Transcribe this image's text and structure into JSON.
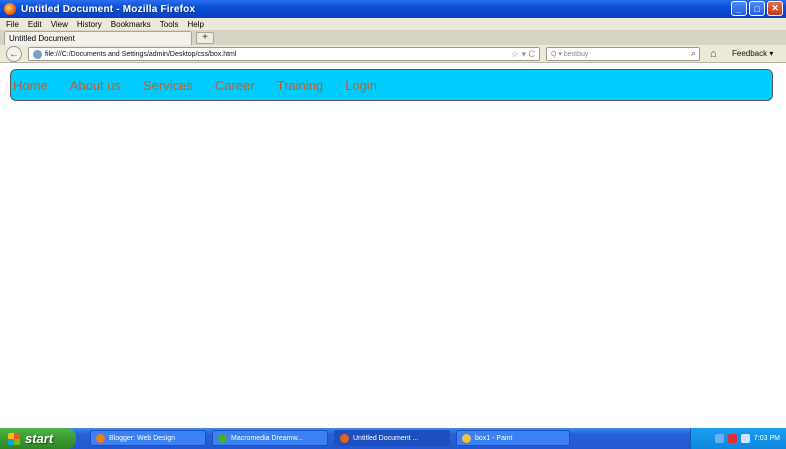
{
  "window": {
    "title": "Untitled Document - Mozilla Firefox",
    "controls": {
      "minimize": "_",
      "maximize": "□",
      "close": "✕"
    }
  },
  "menu": [
    "File",
    "Edit",
    "View",
    "History",
    "Bookmarks",
    "Tools",
    "Help"
  ],
  "tabs": [
    {
      "label": "Untitled Document"
    }
  ],
  "new_tab_label": "+",
  "navigation": {
    "back_icon": "←",
    "url": "file:///C:/Documents and Settings/admin/Desktop/css/box.html",
    "url_icons": "☆ ▾ C",
    "search_placeholder": "Q ▾ bestbuy",
    "search_icon": "magnifier-icon",
    "home_icon": "⌂",
    "feedback_label": "Feedback ▾"
  },
  "site": {
    "nav_color": "#00ccff",
    "link_color": "#cc5a1e",
    "nav_items": [
      "Home",
      "About us",
      "Services",
      "Career",
      "Training",
      "Login"
    ]
  },
  "taskbar": {
    "start_label": "start",
    "tasks": [
      {
        "label": "Blogger: Web Design",
        "icon_color": "#e8801a"
      },
      {
        "label": "Macromedia Dreamw...",
        "icon_color": "#4caa3a"
      },
      {
        "label": "Untitled Document ...",
        "icon_color": "#e8611a"
      },
      {
        "label": "box1 - Paint",
        "icon_color": "#f0c040"
      }
    ],
    "clock": "7:03 PM"
  }
}
